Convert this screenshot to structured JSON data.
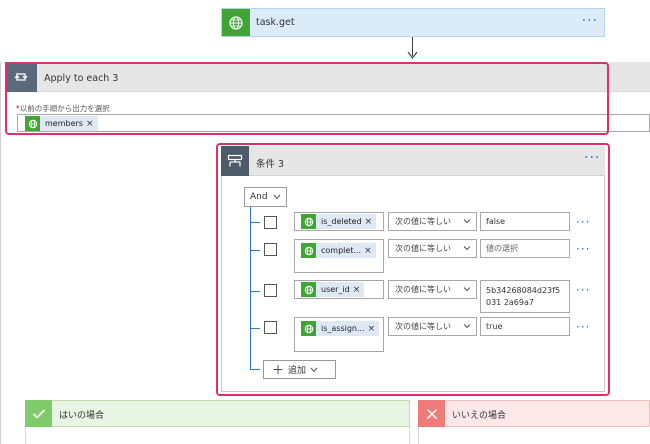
{
  "task_card": {
    "title": "task.get",
    "more": "···"
  },
  "apply": {
    "title": "Apply to each 3",
    "required_star": "*",
    "field_label": "以前の手順から出力を選択",
    "token": {
      "name": "members",
      "remove": "×"
    }
  },
  "condition": {
    "title": "条件 3",
    "more": "···",
    "group_op": "And",
    "rows": [
      {
        "token": "is_deleted",
        "remove": "×",
        "operator": "次の値に等しい",
        "value": "false",
        "value_placeholder": false,
        "more": "···"
      },
      {
        "token": "complet...",
        "remove": "×",
        "operator": "次の値に等しい",
        "value": "値の選択",
        "value_placeholder": true,
        "more": "···"
      },
      {
        "token": "user_id",
        "remove": "×",
        "operator": "次の値に等しい",
        "value": "5b34268084d23f5031 2a69a7",
        "value_placeholder": false,
        "more": "···"
      },
      {
        "token": "is_assign...",
        "remove": "×",
        "operator": "次の値に等しい",
        "value": "true",
        "value_placeholder": false,
        "more": "···"
      }
    ],
    "add_label": "追加"
  },
  "branches": {
    "yes_label": "はいの場合",
    "no_label": "いいえの場合"
  },
  "colors": {
    "accent": "#2b79d3",
    "connector_green": "#3fa535",
    "highlight": "#e0306a",
    "yes": "#7fcb69",
    "no": "#ef7b7b"
  }
}
